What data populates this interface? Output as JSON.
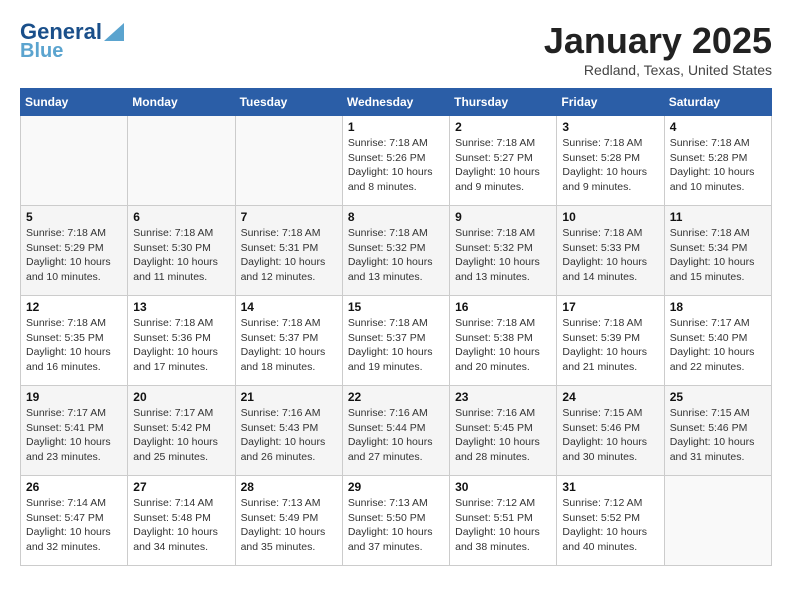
{
  "header": {
    "logo_line1": "General",
    "logo_line2": "Blue",
    "month": "January 2025",
    "location": "Redland, Texas, United States"
  },
  "weekdays": [
    "Sunday",
    "Monday",
    "Tuesday",
    "Wednesday",
    "Thursday",
    "Friday",
    "Saturday"
  ],
  "weeks": [
    [
      {
        "day": "",
        "info": ""
      },
      {
        "day": "",
        "info": ""
      },
      {
        "day": "",
        "info": ""
      },
      {
        "day": "1",
        "info": "Sunrise: 7:18 AM\nSunset: 5:26 PM\nDaylight: 10 hours\nand 8 minutes."
      },
      {
        "day": "2",
        "info": "Sunrise: 7:18 AM\nSunset: 5:27 PM\nDaylight: 10 hours\nand 9 minutes."
      },
      {
        "day": "3",
        "info": "Sunrise: 7:18 AM\nSunset: 5:28 PM\nDaylight: 10 hours\nand 9 minutes."
      },
      {
        "day": "4",
        "info": "Sunrise: 7:18 AM\nSunset: 5:28 PM\nDaylight: 10 hours\nand 10 minutes."
      }
    ],
    [
      {
        "day": "5",
        "info": "Sunrise: 7:18 AM\nSunset: 5:29 PM\nDaylight: 10 hours\nand 10 minutes."
      },
      {
        "day": "6",
        "info": "Sunrise: 7:18 AM\nSunset: 5:30 PM\nDaylight: 10 hours\nand 11 minutes."
      },
      {
        "day": "7",
        "info": "Sunrise: 7:18 AM\nSunset: 5:31 PM\nDaylight: 10 hours\nand 12 minutes."
      },
      {
        "day": "8",
        "info": "Sunrise: 7:18 AM\nSunset: 5:32 PM\nDaylight: 10 hours\nand 13 minutes."
      },
      {
        "day": "9",
        "info": "Sunrise: 7:18 AM\nSunset: 5:32 PM\nDaylight: 10 hours\nand 13 minutes."
      },
      {
        "day": "10",
        "info": "Sunrise: 7:18 AM\nSunset: 5:33 PM\nDaylight: 10 hours\nand 14 minutes."
      },
      {
        "day": "11",
        "info": "Sunrise: 7:18 AM\nSunset: 5:34 PM\nDaylight: 10 hours\nand 15 minutes."
      }
    ],
    [
      {
        "day": "12",
        "info": "Sunrise: 7:18 AM\nSunset: 5:35 PM\nDaylight: 10 hours\nand 16 minutes."
      },
      {
        "day": "13",
        "info": "Sunrise: 7:18 AM\nSunset: 5:36 PM\nDaylight: 10 hours\nand 17 minutes."
      },
      {
        "day": "14",
        "info": "Sunrise: 7:18 AM\nSunset: 5:37 PM\nDaylight: 10 hours\nand 18 minutes."
      },
      {
        "day": "15",
        "info": "Sunrise: 7:18 AM\nSunset: 5:37 PM\nDaylight: 10 hours\nand 19 minutes."
      },
      {
        "day": "16",
        "info": "Sunrise: 7:18 AM\nSunset: 5:38 PM\nDaylight: 10 hours\nand 20 minutes."
      },
      {
        "day": "17",
        "info": "Sunrise: 7:18 AM\nSunset: 5:39 PM\nDaylight: 10 hours\nand 21 minutes."
      },
      {
        "day": "18",
        "info": "Sunrise: 7:17 AM\nSunset: 5:40 PM\nDaylight: 10 hours\nand 22 minutes."
      }
    ],
    [
      {
        "day": "19",
        "info": "Sunrise: 7:17 AM\nSunset: 5:41 PM\nDaylight: 10 hours\nand 23 minutes."
      },
      {
        "day": "20",
        "info": "Sunrise: 7:17 AM\nSunset: 5:42 PM\nDaylight: 10 hours\nand 25 minutes."
      },
      {
        "day": "21",
        "info": "Sunrise: 7:16 AM\nSunset: 5:43 PM\nDaylight: 10 hours\nand 26 minutes."
      },
      {
        "day": "22",
        "info": "Sunrise: 7:16 AM\nSunset: 5:44 PM\nDaylight: 10 hours\nand 27 minutes."
      },
      {
        "day": "23",
        "info": "Sunrise: 7:16 AM\nSunset: 5:45 PM\nDaylight: 10 hours\nand 28 minutes."
      },
      {
        "day": "24",
        "info": "Sunrise: 7:15 AM\nSunset: 5:46 PM\nDaylight: 10 hours\nand 30 minutes."
      },
      {
        "day": "25",
        "info": "Sunrise: 7:15 AM\nSunset: 5:46 PM\nDaylight: 10 hours\nand 31 minutes."
      }
    ],
    [
      {
        "day": "26",
        "info": "Sunrise: 7:14 AM\nSunset: 5:47 PM\nDaylight: 10 hours\nand 32 minutes."
      },
      {
        "day": "27",
        "info": "Sunrise: 7:14 AM\nSunset: 5:48 PM\nDaylight: 10 hours\nand 34 minutes."
      },
      {
        "day": "28",
        "info": "Sunrise: 7:13 AM\nSunset: 5:49 PM\nDaylight: 10 hours\nand 35 minutes."
      },
      {
        "day": "29",
        "info": "Sunrise: 7:13 AM\nSunset: 5:50 PM\nDaylight: 10 hours\nand 37 minutes."
      },
      {
        "day": "30",
        "info": "Sunrise: 7:12 AM\nSunset: 5:51 PM\nDaylight: 10 hours\nand 38 minutes."
      },
      {
        "day": "31",
        "info": "Sunrise: 7:12 AM\nSunset: 5:52 PM\nDaylight: 10 hours\nand 40 minutes."
      },
      {
        "day": "",
        "info": ""
      }
    ]
  ]
}
